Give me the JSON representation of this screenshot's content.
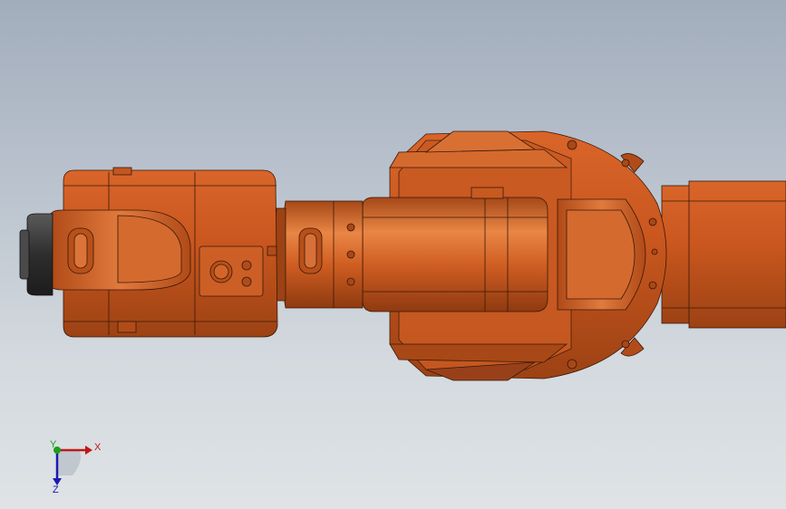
{
  "viewport": {
    "background_top": "#a2adbc",
    "background_bottom": "#dfe3e6"
  },
  "model": {
    "body_color": "#c8561e",
    "highlight_color": "#e07a3d",
    "shadow_color": "#8e3a10",
    "edge_color": "#3a1808",
    "flange_color": "#3c3c3c"
  },
  "triad": {
    "x_label": "X",
    "y_label": "Y",
    "z_label": "Z",
    "x_color": "#c01818",
    "y_color": "#1aa01a",
    "z_color": "#1a1ab0"
  }
}
